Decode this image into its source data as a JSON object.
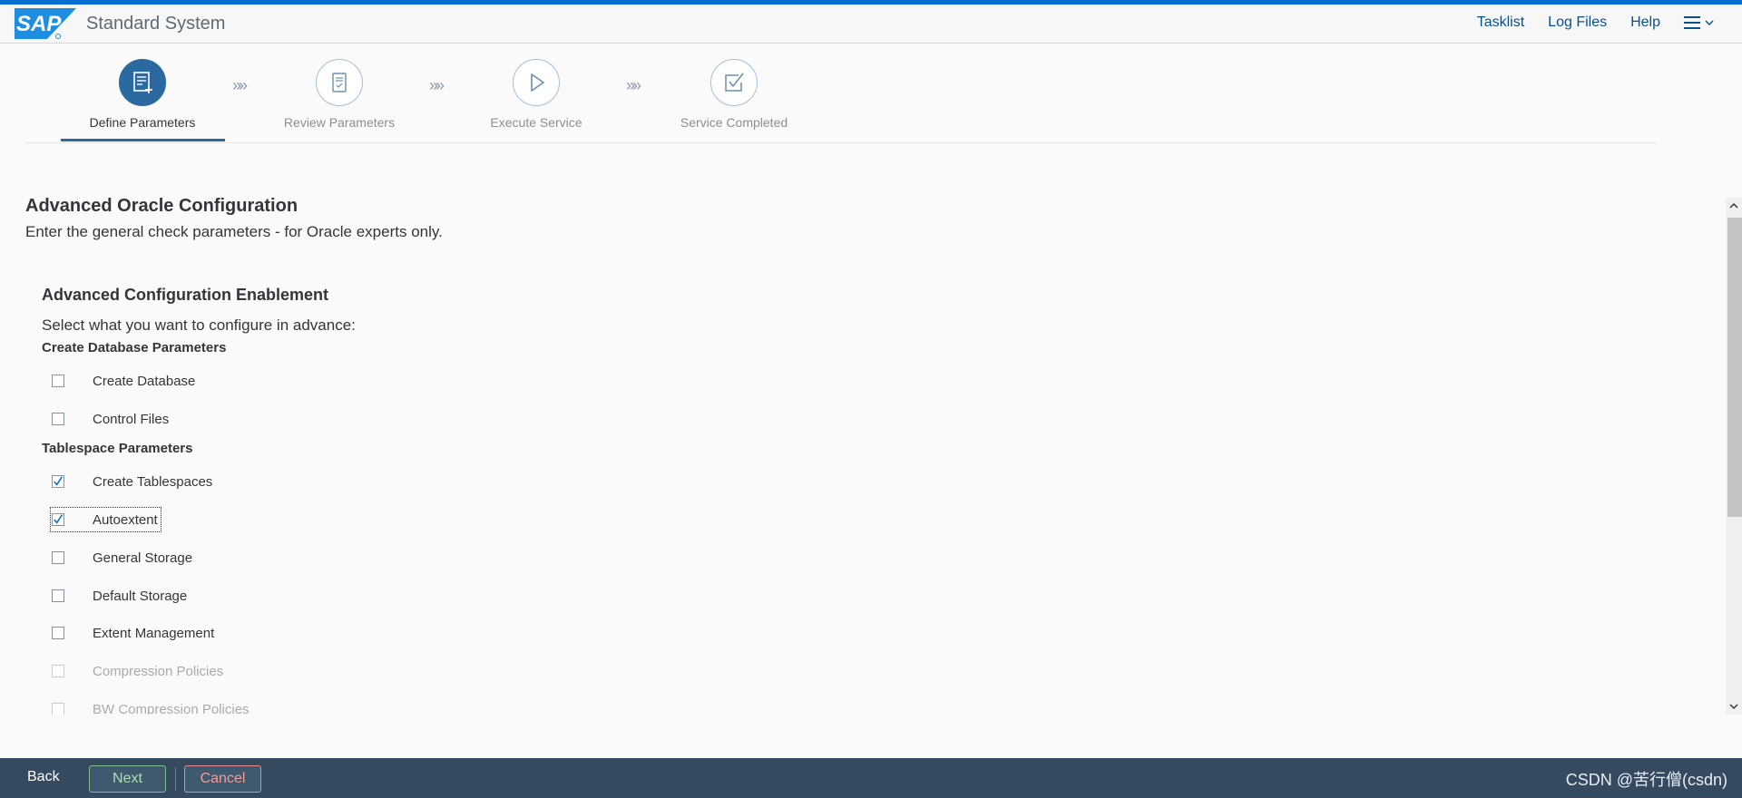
{
  "shell": {
    "logo_text": "SAP",
    "title": "Standard System",
    "links": [
      "Tasklist",
      "Log Files",
      "Help"
    ]
  },
  "wizard": {
    "steps": [
      {
        "label": "Define Parameters",
        "icon": "define-parameters-icon",
        "active": true
      },
      {
        "label": "Review Parameters",
        "icon": "review-parameters-icon",
        "active": false
      },
      {
        "label": "Execute Service",
        "icon": "execute-service-icon",
        "active": false
      },
      {
        "label": "Service Completed",
        "icon": "service-completed-icon",
        "active": false
      }
    ],
    "separator": "»»"
  },
  "main": {
    "title": "Advanced Oracle Configuration",
    "subtitle": "Enter the general check parameters - for Oracle experts only.",
    "section_title": "Advanced Configuration Enablement",
    "section_subtitle": "Select what you want to configure in advance:",
    "groups": [
      {
        "title": "Create Database Parameters",
        "options": [
          {
            "label": "Create Database",
            "checked": false
          },
          {
            "label": "Control Files",
            "checked": false
          }
        ]
      },
      {
        "title": "Tablespace Parameters",
        "options": [
          {
            "label": "Create Tablespaces",
            "checked": true
          },
          {
            "label": "Autoextent",
            "checked": true
          },
          {
            "label": "General Storage",
            "checked": false
          },
          {
            "label": "Default Storage",
            "checked": false
          },
          {
            "label": "Extent Management",
            "checked": false
          },
          {
            "label": "Compression Policies",
            "checked": false
          },
          {
            "label": "BW Compression Policies",
            "checked": false
          }
        ]
      }
    ]
  },
  "footer": {
    "back_label": "Back",
    "next_label": "Next",
    "cancel_label": "Cancel",
    "watermark": "CSDN @苦行僧(csdn)"
  },
  "colors": {
    "accent": "#0a6ed1",
    "active_step": "#2b6aa0",
    "footer_bg": "#354a5f",
    "next_text": "#a7e0b0",
    "cancel_text": "#f49b9b"
  }
}
